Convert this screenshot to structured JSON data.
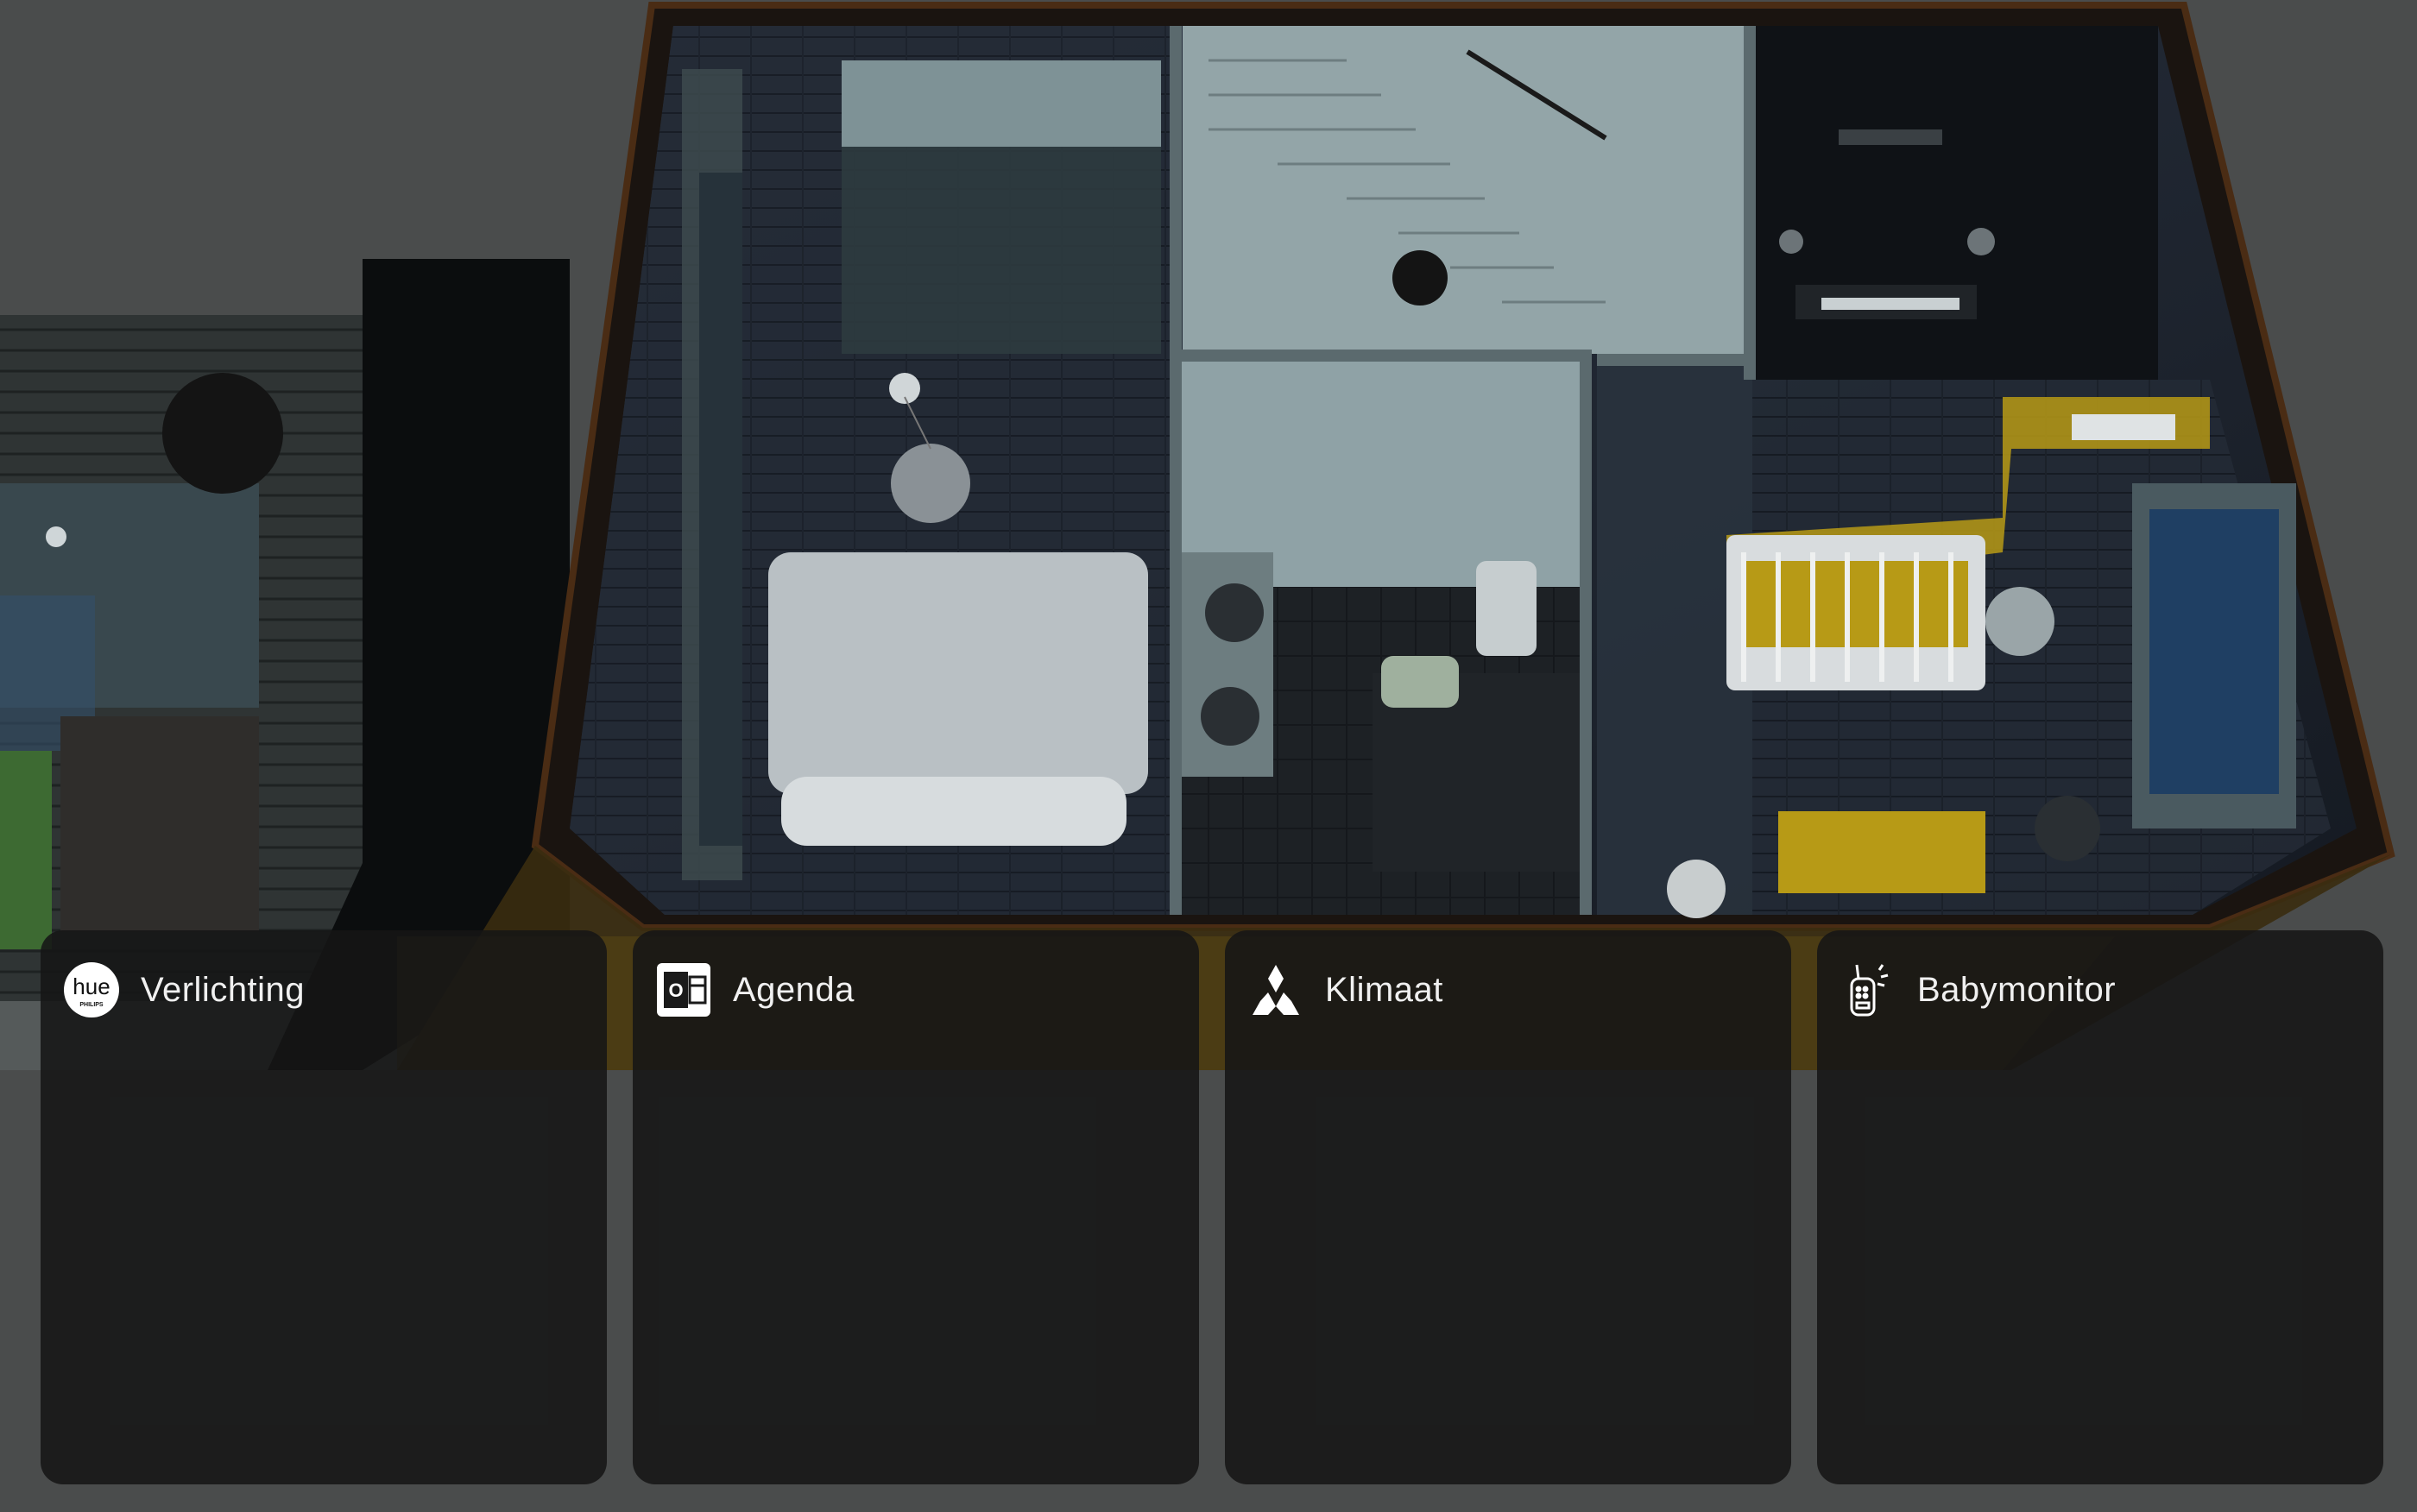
{
  "floorplan": {
    "scene": "isometric-house-floor-night"
  },
  "widgets": [
    {
      "id": "lighting",
      "title": "Verlichting",
      "icon": "hue-logo-icon",
      "icon_text": "hue",
      "icon_subtext": "PHILIPS"
    },
    {
      "id": "calendar",
      "title": "Agenda",
      "icon": "outlook-icon",
      "icon_text": "O"
    },
    {
      "id": "climate",
      "title": "Klimaat",
      "icon": "mitsubishi-logo-icon"
    },
    {
      "id": "babymonitor",
      "title": "Babymonitor",
      "icon": "baby-monitor-icon"
    }
  ],
  "colors": {
    "background": "#4a4c4c",
    "card": "#161616",
    "accent_yellow": "#b79a16",
    "floor_dark": "#1a2230"
  }
}
